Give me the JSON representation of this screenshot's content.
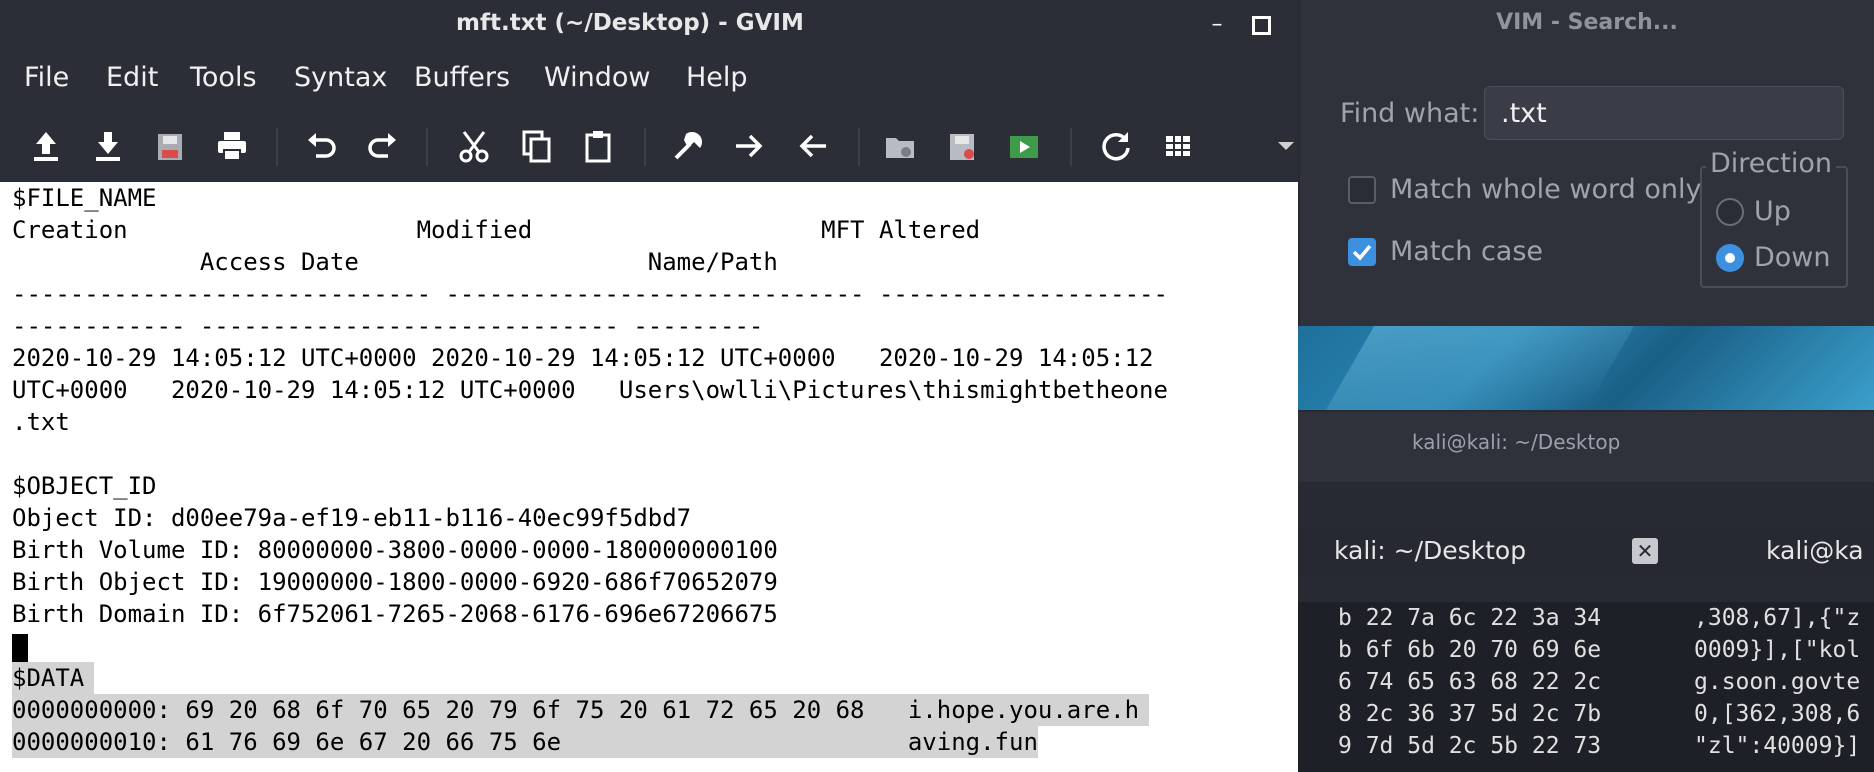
{
  "gvim": {
    "title": "mft.txt (~/Desktop) - GVIM",
    "window_controls": [
      "minimize-icon",
      "maximize-icon"
    ],
    "menu": [
      "File",
      "Edit",
      "Tools",
      "Syntax",
      "Buffers",
      "Window",
      "Help"
    ],
    "toolbar_icons": [
      "upload-icon",
      "download-icon",
      "save-icon",
      "print-icon",
      "undo-icon",
      "redo-icon",
      "cut-icon",
      "copy-icon",
      "paste-icon",
      "find-replace-icon",
      "arrow-right-icon",
      "arrow-left-icon",
      "folder-session-icon",
      "save-session-icon",
      "run-script-icon",
      "refresh-icon",
      "table-icon",
      "dropdown-arrow-icon"
    ],
    "editor_lines": [
      "$FILE_NAME",
      "Creation                    Modified                    MFT Altered",
      "             Access Date                    Name/Path",
      "----------------------------- ----------------------------- --------------------",
      "------------ ----------------------------- ---------",
      "2020-10-29 14:05:12 UTC+0000 2020-10-29 14:05:12 UTC+0000   2020-10-29 14:05:12",
      "UTC+0000   2020-10-29 14:05:12 UTC+0000   Users\\owlli\\Pictures\\thismightbetheone",
      ".txt",
      "",
      "$OBJECT_ID",
      "Object ID: d00ee79a-ef19-eb11-b116-40ec99f5dbd7",
      "Birth Volume ID: 80000000-3800-0000-0000-180000000100",
      "Birth Object ID: 19000000-1800-0000-6920-686f70652079",
      "Birth Domain ID: 6f752061-7265-2068-6176-696e67206675",
      "",
      "$DATA",
      "0000000000: 69 20 68 6f 70 65 20 79 6f 75 20 61 72 65 20 68   i.hope.you.are.h",
      "0000000010: 61 76 69 6e 67 20 66 75 6e                        aving.fun"
    ]
  },
  "search_dialog": {
    "title": "VIM - Search...",
    "find_label": "Find what:",
    "find_value": ".txt",
    "match_whole_word_label": "Match whole word only",
    "match_whole_word_checked": false,
    "match_case_label": "Match case",
    "match_case_checked": true,
    "direction_label": "Direction",
    "direction_up": "Up",
    "direction_down": "Down",
    "direction_selected": "Down"
  },
  "terminal": {
    "window_title": "kali@kali: ~/Desktop",
    "tab1_label": "kali: ~/Desktop",
    "tab2_label": "kali@ka",
    "hex_col": "b 22 7a 6c 22 3a 34\nb 6f 6b 20 70 69 6e\n6 74 65 63 68 22 2c\n8 2c 36 37 5d 2c 7b\n9 7d 5d 2c 5b 22 73",
    "ascii_col": ",308,67],{\"z\n0009}],[\"kol\ng.soon.govte\n0,[362,308,6\n\"zl\":40009}]"
  },
  "colors": {
    "window_bg": "#2b2e37",
    "editor_bg": "#ffffff",
    "selection": "#d3d3d3",
    "accent_blue": "#3d8fe0"
  }
}
